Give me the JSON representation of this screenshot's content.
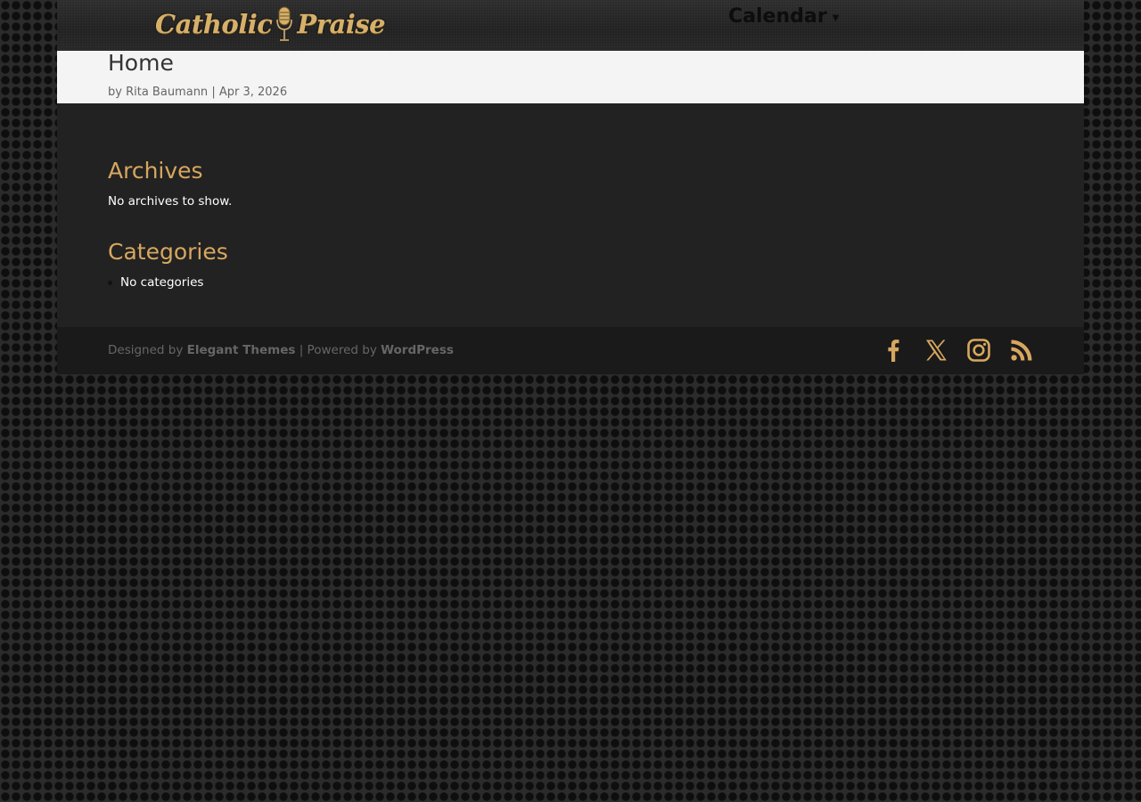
{
  "header": {
    "logo_left": "Catholic",
    "logo_right": "Praise",
    "nav_item": "Calendar",
    "nav_chevron": "chevron-down-icon"
  },
  "title_band": {
    "title": "Home",
    "meta_by": "by",
    "author": "Rita Baumann",
    "separator": "|",
    "date": "Apr 3, 2026"
  },
  "widgets": {
    "archives_title": "Archives",
    "archives_text": "No archives to show.",
    "categories_title": "Categories",
    "categories_text": "No categories"
  },
  "footer": {
    "designed_by": "Designed by",
    "theme_name": "Elegant Themes",
    "powered_by": "| Powered by",
    "platform": "WordPress",
    "social_icons": [
      "facebook-icon",
      "x-icon",
      "instagram-icon",
      "rss-icon"
    ]
  },
  "colors": {
    "accent": "#d7a75f",
    "content_bg": "#222222",
    "title_band_bg": "#f4f4f4",
    "footer_bg": "#1a1a1a",
    "footer_text": "#666666"
  }
}
